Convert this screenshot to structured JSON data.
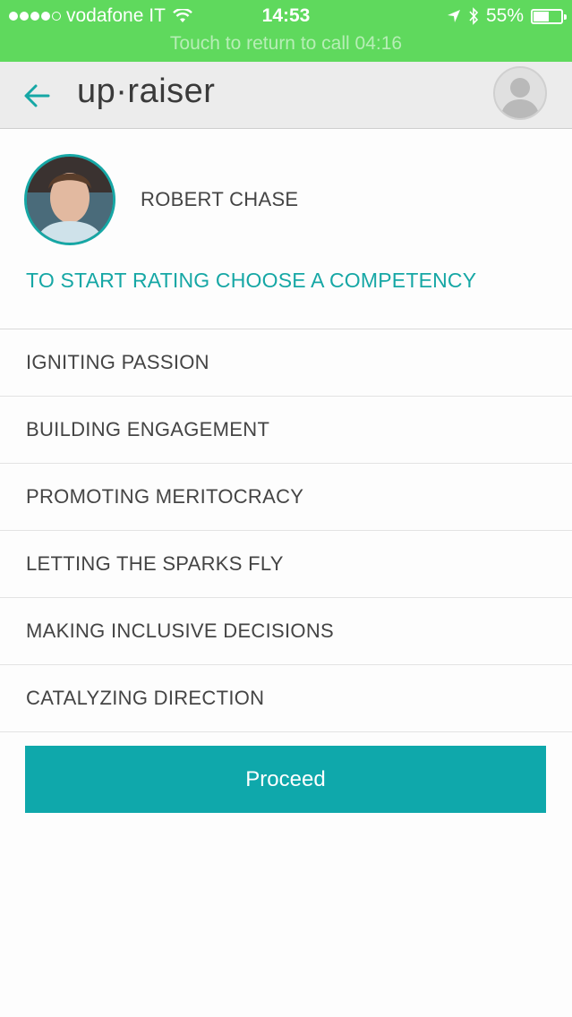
{
  "status_bar": {
    "carrier": "vodafone IT",
    "time": "14:53",
    "battery": "55%",
    "battery_level": 0.55,
    "call_banner": "Touch to return to call 04:16"
  },
  "header": {
    "logo": "up·raiser",
    "back_icon": "arrow-left-icon",
    "avatar_icon": "user-silhouette-icon"
  },
  "profile": {
    "name": "ROBERT CHASE"
  },
  "prompt": "TO START RATING CHOOSE A COMPETENCY",
  "competencies": [
    "IGNITING PASSION",
    "BUILDING ENGAGEMENT",
    "PROMOTING MERITOCRACY",
    "LETTING THE SPARKS FLY",
    "MAKING INCLUSIVE DECISIONS",
    "CATALYZING DIRECTION"
  ],
  "proceed_label": "Proceed",
  "colors": {
    "status_bar": "#5fd95d",
    "accent": "#16a7a5",
    "button": "#0fa8ab"
  }
}
